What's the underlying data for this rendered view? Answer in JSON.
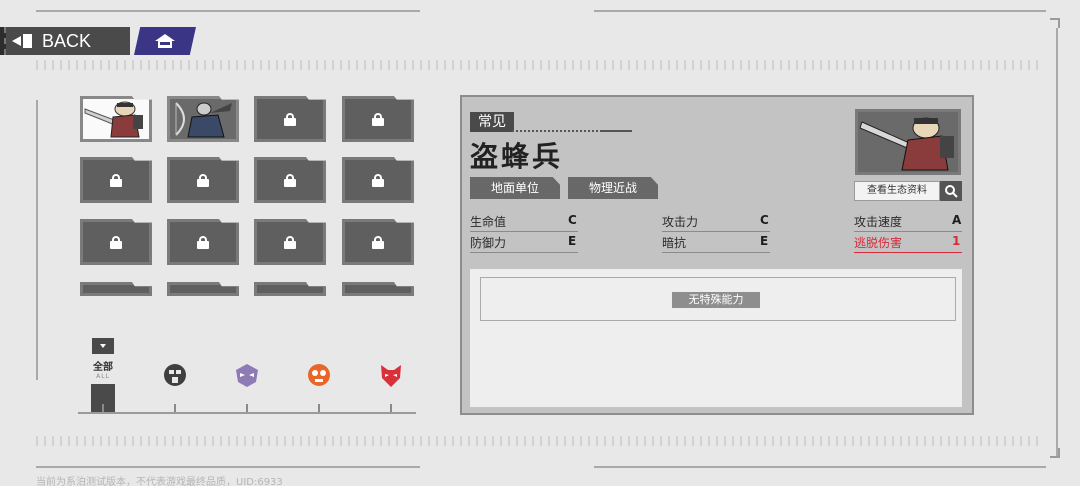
{
  "nav": {
    "back_label": "BACK"
  },
  "grid": {
    "slots": [
      {
        "state": "unlocked"
      },
      {
        "state": "unlocked"
      },
      {
        "state": "locked"
      },
      {
        "state": "locked"
      },
      {
        "state": "locked"
      },
      {
        "state": "locked"
      },
      {
        "state": "locked"
      },
      {
        "state": "locked"
      },
      {
        "state": "locked"
      },
      {
        "state": "locked"
      },
      {
        "state": "locked"
      },
      {
        "state": "locked"
      }
    ]
  },
  "filters": {
    "all_label": "全部",
    "all_sub": "ALL",
    "faction_icons": [
      "faction-mask-dark-icon",
      "faction-mask-purple-icon",
      "faction-mask-orange-icon",
      "faction-mask-red-icon"
    ],
    "colors": [
      "#3f3f3f",
      "#8e7ab5",
      "#e8662a",
      "#d9303a"
    ]
  },
  "unit": {
    "rarity": "常见",
    "name": "盗蜂兵",
    "tags": [
      "地面单位",
      "物理近战"
    ],
    "bio_button": "查看生态资料",
    "stats": [
      {
        "label": "生命值",
        "grade": "C"
      },
      {
        "label": "攻击力",
        "grade": "C"
      },
      {
        "label": "攻击速度",
        "grade": "A"
      },
      {
        "label": "防御力",
        "grade": "E"
      },
      {
        "label": "暗抗",
        "grade": "E"
      },
      {
        "label": "逃脱伤害",
        "grade": "1"
      }
    ],
    "ability": "无特殊能力"
  },
  "footer": {
    "notice": "当前为系泊测试版本，不代表游戏最终品质，UID:6933"
  }
}
